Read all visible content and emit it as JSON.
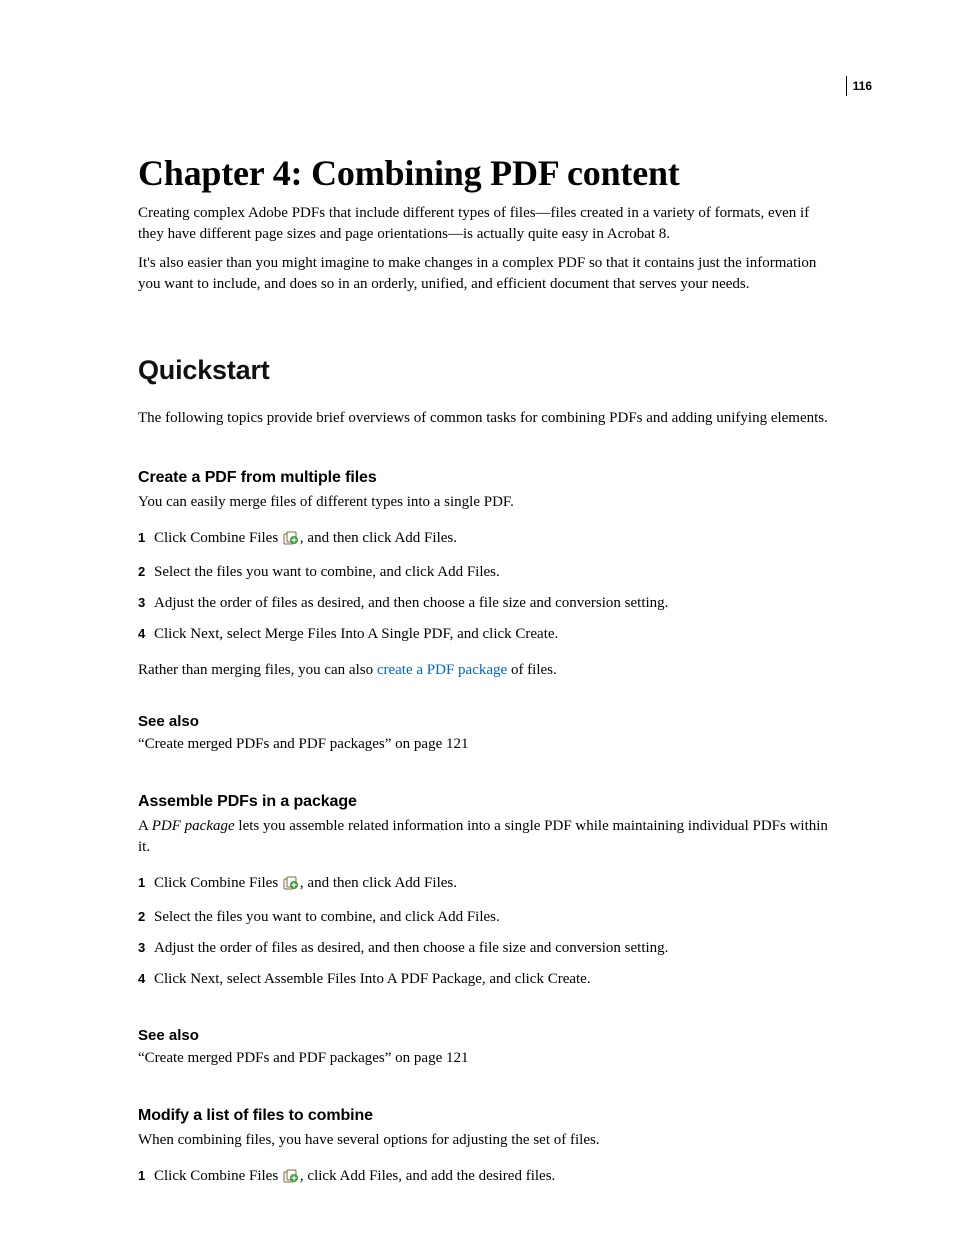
{
  "page_number": "116",
  "chapter_title": "Chapter 4: Combining PDF content",
  "intro_p1": "Creating complex Adobe PDFs that include different types of files—files created in a variety of formats, even if they have different page sizes and page orientations—is actually quite easy in Acrobat 8.",
  "intro_p2": "It's also easier than you might imagine to make changes in a complex PDF so that it contains just the information you want to include, and does so in an orderly, unified, and efficient document that serves your needs.",
  "section_title": "Quickstart",
  "section_intro": "The following topics provide brief overviews of common tasks for combining PDFs and adding unifying elements.",
  "topic1": {
    "heading": "Create a PDF from multiple files",
    "intro": "You can easily merge files of different types into a single PDF.",
    "step1_a": "Click Combine Files ",
    "step1_b": ", and then click Add Files.",
    "step2": "Select the files you want to combine, and click Add Files.",
    "step3": "Adjust the order of files as desired, and then choose a file size and conversion setting.",
    "step4": "Click Next, select Merge Files Into A Single PDF, and click Create.",
    "after_a": "Rather than merging files, you can also ",
    "after_link": "create a PDF package",
    "after_b": " of files."
  },
  "see_also_label": "See also",
  "see_also_ref": "“Create merged PDFs and PDF packages” on page 121",
  "topic2": {
    "heading": "Assemble PDFs in a package",
    "intro_a": "A ",
    "intro_term": "PDF package",
    "intro_b": " lets you assemble related information into a single PDF while maintaining individual PDFs within it.",
    "step1_a": "Click Combine Files ",
    "step1_b": ", and then click Add Files.",
    "step2": "Select the files you want to combine, and click Add Files.",
    "step3": "Adjust the order of files as desired, and then choose a file size and conversion setting.",
    "step4": "Click Next, select Assemble Files Into A PDF Package, and click Create."
  },
  "topic3": {
    "heading": "Modify a list of files to combine",
    "intro": "When combining files, you have several options for adjusting the set of files.",
    "step1_a": "Click Combine Files ",
    "step1_b": ", click Add Files, and add the desired files."
  },
  "nums": {
    "n1": "1",
    "n2": "2",
    "n3": "3",
    "n4": "4"
  }
}
